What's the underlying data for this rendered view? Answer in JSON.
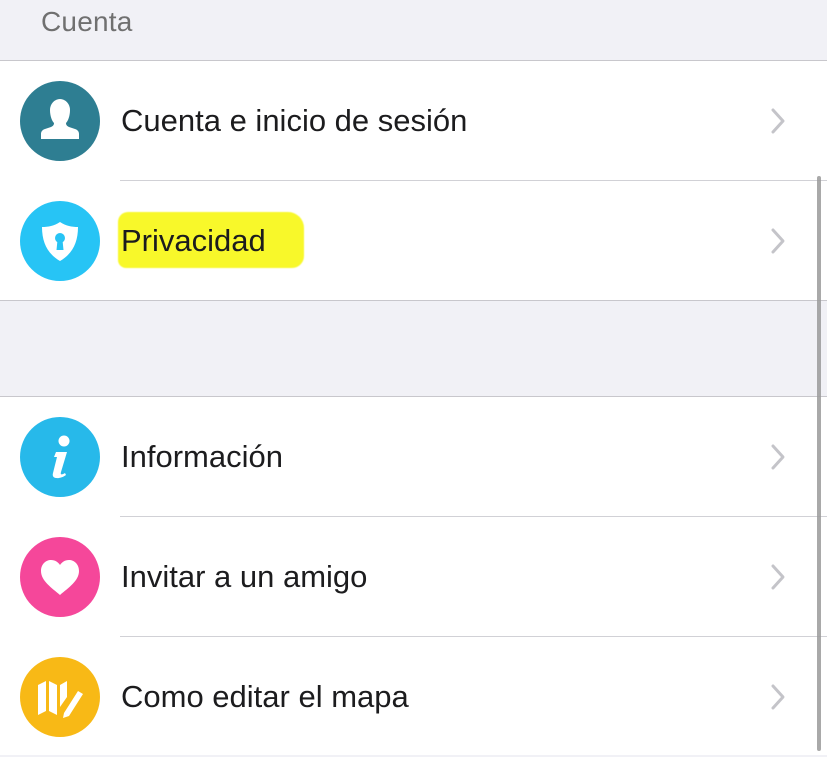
{
  "section": {
    "title": "Cuenta"
  },
  "group1": {
    "items": [
      {
        "label": "Cuenta e inicio de sesión",
        "icon": "person-icon",
        "color": "#2e7e92"
      },
      {
        "label": "Privacidad",
        "icon": "shield-keyhole-icon",
        "color": "#27c4f5",
        "highlight": "#f8f82a"
      }
    ]
  },
  "group2": {
    "items": [
      {
        "label": "Información",
        "icon": "info-icon",
        "color": "#27b9ea"
      },
      {
        "label": "Invitar a un amigo",
        "icon": "heart-icon",
        "color": "#f5479a"
      },
      {
        "label": "Como editar el mapa",
        "icon": "map-pencil-icon",
        "color": "#f8b916"
      }
    ]
  },
  "colors": {
    "background": "#f1f1f6",
    "text": "#1c1c1e",
    "chevron": "#c4c4c9"
  }
}
